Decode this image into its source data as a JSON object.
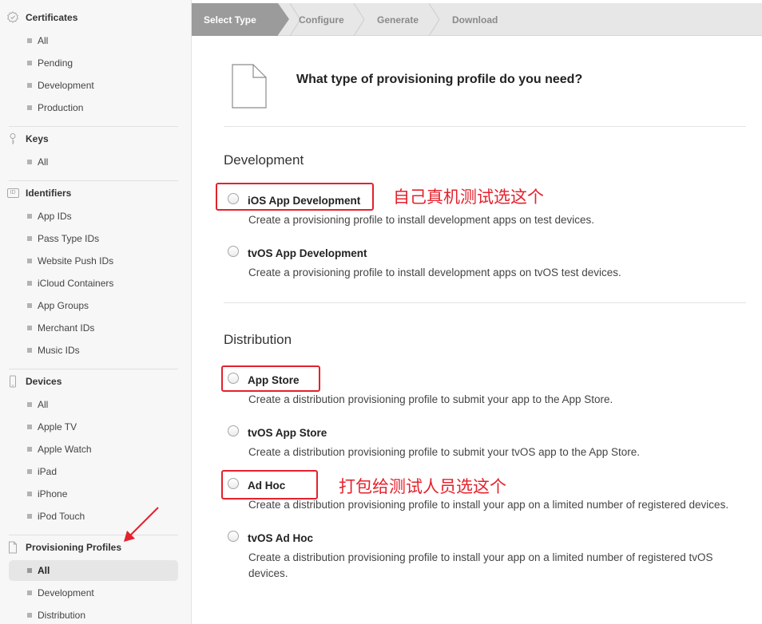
{
  "sidebar": {
    "certificates": {
      "title": "Certificates",
      "icon": "certificate-icon",
      "items": [
        "All",
        "Pending",
        "Development",
        "Production"
      ]
    },
    "keys": {
      "title": "Keys",
      "icon": "key-icon",
      "items": [
        "All"
      ]
    },
    "identifiers": {
      "title": "Identifiers",
      "icon": "id-icon",
      "icon_text": "ID",
      "items": [
        "App IDs",
        "Pass Type IDs",
        "Website Push IDs",
        "iCloud Containers",
        "App Groups",
        "Merchant IDs",
        "Music IDs"
      ]
    },
    "devices": {
      "title": "Devices",
      "icon": "device-icon",
      "items": [
        "All",
        "Apple TV",
        "Apple Watch",
        "iPad",
        "iPhone",
        "iPod Touch"
      ]
    },
    "profiles": {
      "title": "Provisioning Profiles",
      "icon": "document-icon",
      "items": [
        "All",
        "Development",
        "Distribution"
      ],
      "active": "All"
    }
  },
  "steps": [
    "Select Type",
    "Configure",
    "Generate",
    "Download"
  ],
  "question": "What type of provisioning profile do you need?",
  "development": {
    "title": "Development",
    "options": [
      {
        "label": "iOS App Development",
        "desc": "Create a provisioning profile to install development apps on test devices.",
        "selected": false
      },
      {
        "label": "tvOS App Development",
        "desc": "Create a provisioning profile to install development apps on tvOS test devices.",
        "selected": false
      }
    ]
  },
  "distribution": {
    "title": "Distribution",
    "options": [
      {
        "label": "App Store",
        "desc": "Create a distribution provisioning profile to submit your app to the App Store.",
        "selected": false
      },
      {
        "label": "tvOS App Store",
        "desc": "Create a distribution provisioning profile to submit your tvOS app to the App Store.",
        "selected": false
      },
      {
        "label": "Ad Hoc",
        "desc": "Create a distribution provisioning profile to install your app on a limited number of registered devices.",
        "selected": false
      },
      {
        "label": "tvOS Ad Hoc",
        "desc": "Create a distribution provisioning profile to install your app on a limited number of registered tvOS devices.",
        "selected": false
      }
    ]
  },
  "annotations": {
    "dev_note": "自己真机测试选这个",
    "adhoc_note": "打包给测试人员选这个",
    "color": "#e5212d"
  },
  "colors": {
    "step_active_bg": "#9b9b9b",
    "crumb_bg": "#e7e7e7",
    "sidebar_bg": "#f7f7f7"
  }
}
